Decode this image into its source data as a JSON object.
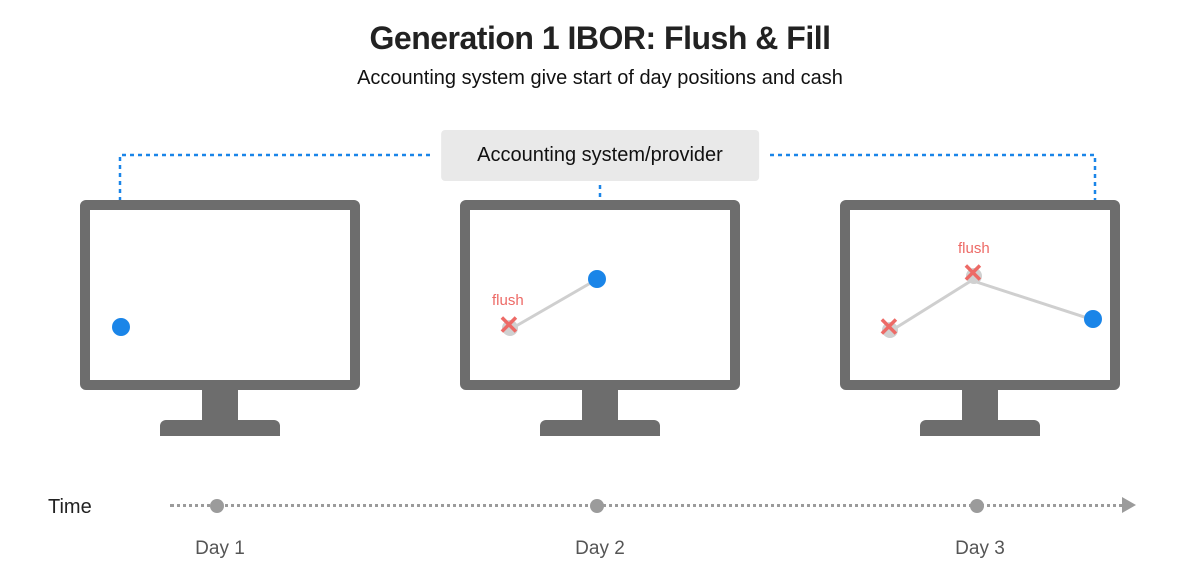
{
  "title": "Generation 1 IBOR: Flush & Fill",
  "subtitle": "Accounting system give start of day positions and cash",
  "provider": "Accounting system/provider",
  "flush_label": "flush",
  "timeline": {
    "label": "Time",
    "days": [
      "Day 1",
      "Day 2",
      "Day 3"
    ]
  }
}
